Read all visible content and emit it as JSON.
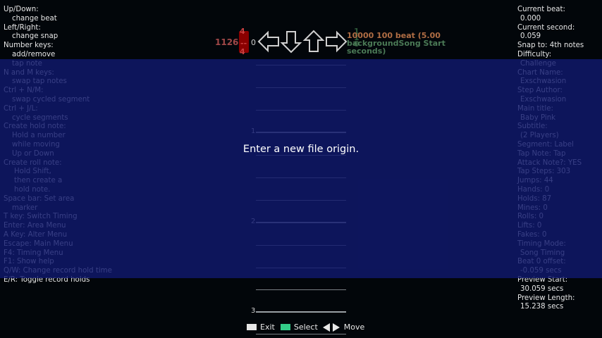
{
  "help_left": [
    {
      "text": "Up/Down:",
      "indent": 0
    },
    {
      "text": "change beat",
      "indent": 1
    },
    {
      "text": "Left/Right:",
      "indent": 0
    },
    {
      "text": "change snap",
      "indent": 1
    },
    {
      "text": "Number keys:",
      "indent": 0
    },
    {
      "text": "add/remove",
      "indent": 1
    },
    {
      "text": "tap note",
      "indent": 1
    },
    {
      "text": "N and M keys:",
      "indent": 0
    },
    {
      "text": "swap tap notes",
      "indent": 1
    },
    {
      "text": "Ctrl + N/M:",
      "indent": 0
    },
    {
      "text": "swap cycled segment",
      "indent": 1
    },
    {
      "text": "Ctrl + J/L:",
      "indent": 0
    },
    {
      "text": "cycle segments",
      "indent": 1
    },
    {
      "text": "Create hold note:",
      "indent": 0
    },
    {
      "text": "Hold a number",
      "indent": 1
    },
    {
      "text": "while moving",
      "indent": 1
    },
    {
      "text": "Up or Down",
      "indent": 1
    },
    {
      "text": "Create roll note:",
      "indent": 0
    },
    {
      "text": "Hold Shift,",
      "indent": 2
    },
    {
      "text": "then create a",
      "indent": 2
    },
    {
      "text": "hold note.",
      "indent": 2
    },
    {
      "text": "Space bar: Set area",
      "indent": 0
    },
    {
      "text": "marker",
      "indent": 1
    },
    {
      "text": "T key: Switch Timing",
      "indent": 0
    },
    {
      "text": "Enter: Area Menu",
      "indent": 0
    },
    {
      "text": "A Key: Alter Menu",
      "indent": 0
    },
    {
      "text": "Escape: Main Menu",
      "indent": 0
    },
    {
      "text": "F4: Timing Menu",
      "indent": 0
    },
    {
      "text": "F1: Show help",
      "indent": 0
    },
    {
      "text": "Q/W: Change record hold time",
      "indent": 0
    },
    {
      "text": "E/R: Toggle record holds",
      "indent": 0
    }
  ],
  "info_right": [
    {
      "text": "Current beat:",
      "indent": 0
    },
    {
      "text": "0.000",
      "indent": 1
    },
    {
      "text": "Current second:",
      "indent": 0
    },
    {
      "text": "0.059",
      "indent": 1
    },
    {
      "text": "Snap to: 4th notes",
      "indent": 0
    },
    {
      "text": "Difficulty:",
      "indent": 0
    },
    {
      "text": "Challenge",
      "indent": 1
    },
    {
      "text": "Chart Name:",
      "indent": 0
    },
    {
      "text": "Exschwasion",
      "indent": 1
    },
    {
      "text": "Step Author:",
      "indent": 0
    },
    {
      "text": "Exschwasion",
      "indent": 1
    },
    {
      "text": "Main title:",
      "indent": 0
    },
    {
      "text": "Baby Pink",
      "indent": 1
    },
    {
      "text": "Subtitle:",
      "indent": 0
    },
    {
      "text": "(2 Players)",
      "indent": 1
    },
    {
      "text": "Segment: Label",
      "indent": 0
    },
    {
      "text": "Tap Note: Tap",
      "indent": 0
    },
    {
      "text": "Attack Note?: YES",
      "indent": 0
    },
    {
      "text": "Tap Steps: 303",
      "indent": 0
    },
    {
      "text": "Jumps: 44",
      "indent": 0
    },
    {
      "text": "Hands: 0",
      "indent": 0
    },
    {
      "text": "Holds: 87",
      "indent": 0
    },
    {
      "text": "Mines: 0",
      "indent": 0
    },
    {
      "text": "Rolls: 0",
      "indent": 0
    },
    {
      "text": "Lifts: 0",
      "indent": 0
    },
    {
      "text": "Fakes: 0",
      "indent": 0
    },
    {
      "text": "Timing Mode:",
      "indent": 0
    },
    {
      "text": "Song Timing",
      "indent": 1
    },
    {
      "text": "Beat 0 offset:",
      "indent": 0
    },
    {
      "text": "-0.059 secs",
      "indent": 1
    },
    {
      "text": "Preview Start:",
      "indent": 0
    },
    {
      "text": "30.059 secs",
      "indent": 1
    },
    {
      "text": "Preview Length:",
      "indent": 0
    },
    {
      "text": "15.238 secs",
      "indent": 1
    }
  ],
  "header": {
    "combo": "1126",
    "snap_top": "4",
    "snap_dash": "--",
    "snap_bottom": "4",
    "beat_zero": "0",
    "bg_markers": [
      "1",
      "1",
      "0"
    ],
    "song_start_line1": "10000 100 beat (5.00",
    "song_start_line2": "backgroundSong Start",
    "song_start_line3": "seconds)"
  },
  "receptors": [
    {
      "icon": "left-arrow-icon"
    },
    {
      "icon": "down-arrow-icon"
    },
    {
      "icon": "up-arrow-icon"
    },
    {
      "icon": "right-arrow-icon"
    }
  ],
  "measures": [
    {
      "label": "1"
    },
    {
      "label": "2"
    },
    {
      "label": "3"
    }
  ],
  "prompt": "Enter a new file origin.",
  "footer": {
    "exit_label": "Exit",
    "select_label": "Select",
    "move_label": "Move"
  },
  "colors": {
    "overlay": "#10186e",
    "select_key": "#33cc88",
    "snap_box": "#8a0000"
  }
}
